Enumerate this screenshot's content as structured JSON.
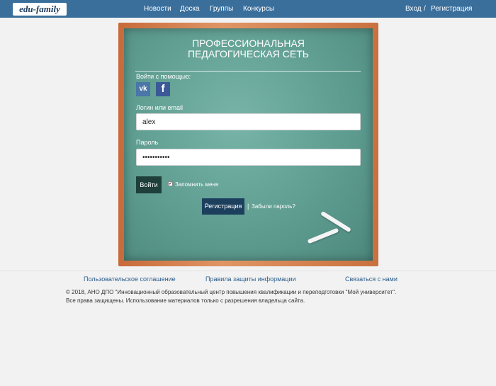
{
  "header": {
    "logo": "edu-family",
    "nav": [
      "Новости",
      "Доска",
      "Группы",
      "Конкурсы"
    ],
    "login": "Вход",
    "separator": "/",
    "register": "Регистрация"
  },
  "board": {
    "title_line1": "ПРОФЕССИОНАЛЬНАЯ",
    "title_line2": "ПЕДАГОГИЧЕСКАЯ СЕТЬ",
    "social_label": "Войти с помощью:",
    "vk_icon_text": "vk",
    "fb_icon_text": "f",
    "login_label": "Логин или email",
    "login_value": "alex",
    "password_label": "Пароль",
    "password_value": "•••••••••••",
    "login_button": "Войти",
    "remember_label": "Запомнить меня",
    "remember_checked": true,
    "register_button": "Регистрация",
    "forgot_separator": "|",
    "forgot_link": "Забыли пароль?"
  },
  "footer": {
    "links": [
      "Пользовательское соглашение",
      "Правила защиты информации",
      "Связаться с нами"
    ],
    "copyright_line1": "© 2018, АНО ДПО \"Инновационный образовательный центр повышения квалификации и переподготовки \"Мой университет\".",
    "copyright_line2": "Все права защищены. Использование материалов только с разрешения владельца сайта."
  },
  "icons": {
    "vk": "vk-icon",
    "facebook": "facebook-icon",
    "checkbox": "checkbox-checked-icon",
    "chalk": "chalk-icon"
  },
  "colors": {
    "navbar": "#3a6f9c",
    "board_frame": "#c86a3a",
    "board_surface": "#5f9d91",
    "link": "#2b5d8c",
    "vk": "#4a76a8",
    "facebook": "#3b5998"
  }
}
